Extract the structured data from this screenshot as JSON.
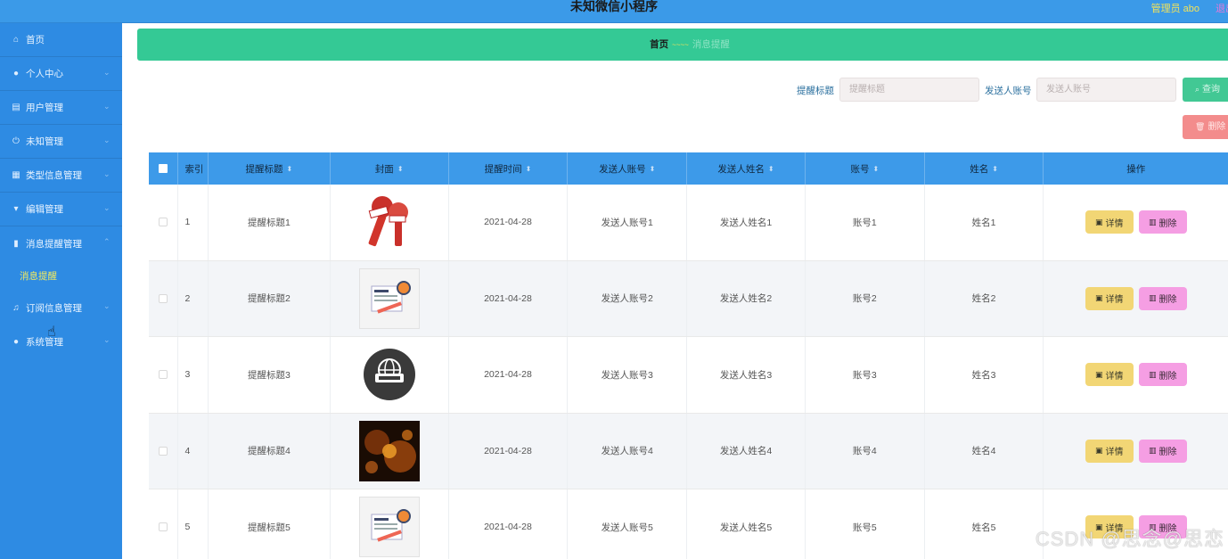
{
  "header": {
    "title": "未知微信小程序",
    "admin_text": "管理员 abo",
    "logout_text": "退出"
  },
  "sidebar": {
    "items": [
      {
        "label": "首页",
        "icon": "home-icon",
        "has_chevron": false
      },
      {
        "label": "个人中心",
        "icon": "user-icon",
        "has_chevron": true
      },
      {
        "label": "用户管理",
        "icon": "calendar-icon",
        "has_chevron": true
      },
      {
        "label": "未知管理",
        "icon": "power-icon",
        "has_chevron": true
      },
      {
        "label": "类型信息管理",
        "icon": "grid-icon",
        "has_chevron": true
      },
      {
        "label": "编辑管理",
        "icon": "cup-icon",
        "has_chevron": true
      },
      {
        "label": "消息提醒管理",
        "icon": "bar-chart-icon",
        "has_chevron": true
      },
      {
        "label": "订阅信息管理",
        "icon": "bell-icon",
        "has_chevron": true
      },
      {
        "label": "系统管理",
        "icon": "location-icon",
        "has_chevron": true
      }
    ],
    "sub_item": "消息提醒"
  },
  "breadcrumb": {
    "home": "首页",
    "separator": "~~~~",
    "current": "消息提醒"
  },
  "search": {
    "title_label": "提醒标题",
    "title_placeholder": "提醒标题",
    "account_label": "发送人账号",
    "account_placeholder": "发送人账号",
    "query_button": "查询",
    "delete_button": "删除"
  },
  "table": {
    "columns": [
      "索引",
      "提醒标题",
      "封面",
      "提醒时间",
      "发送人账号",
      "发送人姓名",
      "账号",
      "姓名",
      "操作"
    ],
    "rows": [
      {
        "index": "1",
        "title": "提醒标题1",
        "cover": "microphone-image",
        "time": "2021-04-28",
        "sender_account": "发送人账号1",
        "sender_name": "发送人姓名1",
        "account": "账号1",
        "name": "姓名1"
      },
      {
        "index": "2",
        "title": "提醒标题2",
        "cover": "news-paper-image",
        "time": "2021-04-28",
        "sender_account": "发送人账号2",
        "sender_name": "发送人姓名2",
        "account": "账号2",
        "name": "姓名2"
      },
      {
        "index": "3",
        "title": "提醒标题3",
        "cover": "news-globe-image",
        "time": "2021-04-28",
        "sender_account": "发送人账号3",
        "sender_name": "发送人姓名3",
        "account": "账号3",
        "name": "姓名3"
      },
      {
        "index": "4",
        "title": "提醒标题4",
        "cover": "dark-fire-image",
        "time": "2021-04-28",
        "sender_account": "发送人账号4",
        "sender_name": "发送人姓名4",
        "account": "账号4",
        "name": "姓名4"
      },
      {
        "index": "5",
        "title": "提醒标题5",
        "cover": "news-paper-image",
        "time": "2021-04-28",
        "sender_account": "发送人账号5",
        "sender_name": "发送人姓名5",
        "account": "账号5",
        "name": "姓名5"
      }
    ],
    "detail_button": "详情",
    "delete_button": "删除"
  },
  "watermark": "CSDN @思念@思恋",
  "colors": {
    "header": "#3b9ae8",
    "sidebar": "#2e8be3",
    "breadcrumb": "#34c995",
    "table_header": "#3d9ae9",
    "detail_button": "#f2d675",
    "delete_button": "#f59ee3"
  }
}
